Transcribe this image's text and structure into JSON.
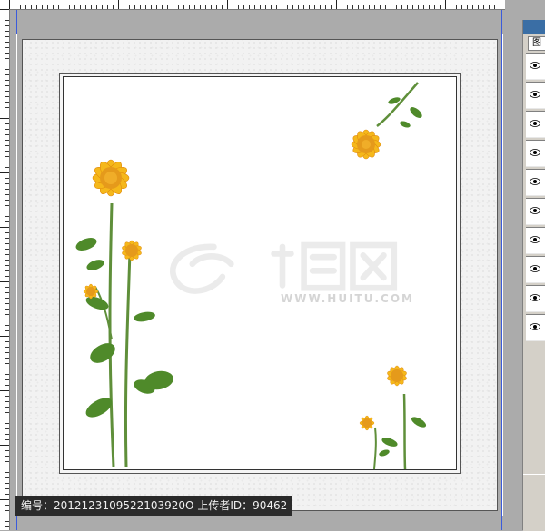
{
  "panel": {
    "tab_label": "图",
    "layer_rows": 10
  },
  "watermark": {
    "text": "WWW.HUITU.COM"
  },
  "caption": {
    "text": "编号：2012123109522103920O 上传者ID：90462"
  },
  "colors": {
    "workspace": "#ababab",
    "canvas_border": "#555555",
    "guide": "#3b5bdb",
    "petal": "#f5b81b",
    "petal_dark": "#e08a0e",
    "leaf": "#4f8a2a",
    "stem": "#5f8f3a"
  },
  "icons": [
    "eye-icon",
    "sunflower-icon"
  ]
}
